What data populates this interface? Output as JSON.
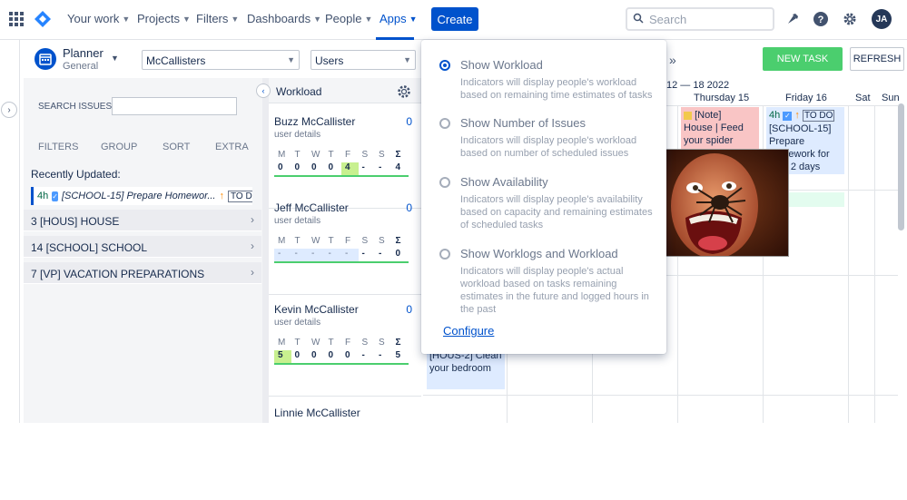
{
  "nav": {
    "items": [
      {
        "label": "Your work"
      },
      {
        "label": "Projects"
      },
      {
        "label": "Filters"
      },
      {
        "label": "Dashboards"
      },
      {
        "label": "People"
      },
      {
        "label": "Apps"
      }
    ],
    "create_label": "Create",
    "search_placeholder": "Search",
    "avatar_initials": "JA"
  },
  "planner": {
    "title": "Planner",
    "subtitle": "General",
    "project_select": "McCallisters",
    "view_select": "Users",
    "new_task_label": "NEW TASK",
    "refresh_label": "REFRESH"
  },
  "left": {
    "search_label": "SEARCH ISSUES:",
    "tabs": [
      "FILTERS",
      "GROUP",
      "SORT",
      "EXTRA"
    ],
    "recent_label": "Recently Updated:",
    "recent_item": {
      "estimate": "4h",
      "text": "[SCHOOL-15] Prepare Homewor...",
      "status": "TO DO"
    },
    "groups": [
      {
        "label": "3 [HOUS] HOUSE"
      },
      {
        "label": "14 [SCHOOL] SCHOOL"
      },
      {
        "label": "7 [VP] VACATION PREPARATIONS"
      }
    ]
  },
  "workload": {
    "title": "Workload",
    "day_letters": [
      "M",
      "T",
      "W",
      "T",
      "F",
      "S",
      "S",
      "Σ"
    ],
    "users": [
      {
        "name": "Buzz McCallister",
        "count": "0",
        "detail": "user details",
        "values": [
          "0",
          "0",
          "0",
          "0",
          "4",
          "-",
          "-",
          "4"
        ]
      },
      {
        "name": "Jeff McCallister",
        "count": "0",
        "detail": "user details",
        "values": [
          "-",
          "-",
          "-",
          "-",
          "-",
          "-",
          "-",
          "0"
        ]
      },
      {
        "name": "Kevin McCallister",
        "count": "0",
        "detail": "user details",
        "values": [
          "5",
          "0",
          "0",
          "0",
          "0",
          "-",
          "-",
          "5"
        ]
      },
      {
        "name": "Linnie McCallister",
        "count": "",
        "detail": "",
        "values": []
      }
    ]
  },
  "calendar": {
    "week_range": "12 — 18 2022",
    "days": [
      "Thursday 15",
      "Friday 16",
      "Sat",
      "Sun"
    ],
    "cards": {
      "note_label": "[Note]",
      "note_text": "House | Feed your spider",
      "school_estimate": "4h",
      "school_status": "TO DO",
      "school_text": "[SCHOOL-15] Prepare homework for next 2 days",
      "hous_text": "[HOUS-2] Clean your bedroom"
    }
  },
  "dropdown": {
    "options": [
      {
        "title": "Show Workload",
        "desc": "Indicators will display people's workload based on remaining time estimates of tasks",
        "selected": true
      },
      {
        "title": "Show Number of Issues",
        "desc": "Indicators will display people's workload based on number of scheduled issues",
        "selected": false
      },
      {
        "title": "Show Availability",
        "desc": "Indicators will display people's availability based on capacity and remaining estimates of scheduled tasks",
        "selected": false
      },
      {
        "title": "Show Worklogs and Workload",
        "desc": "Indicators will display people's actual workload based on tasks remaining estimates in the future and logged hours in the past",
        "selected": false
      }
    ],
    "configure_label": "Configure"
  },
  "colors": {
    "brand": "#0052cc",
    "green": "#4bce6e",
    "note_pink": "#f9c5c5",
    "school_blue": "#deebff"
  }
}
